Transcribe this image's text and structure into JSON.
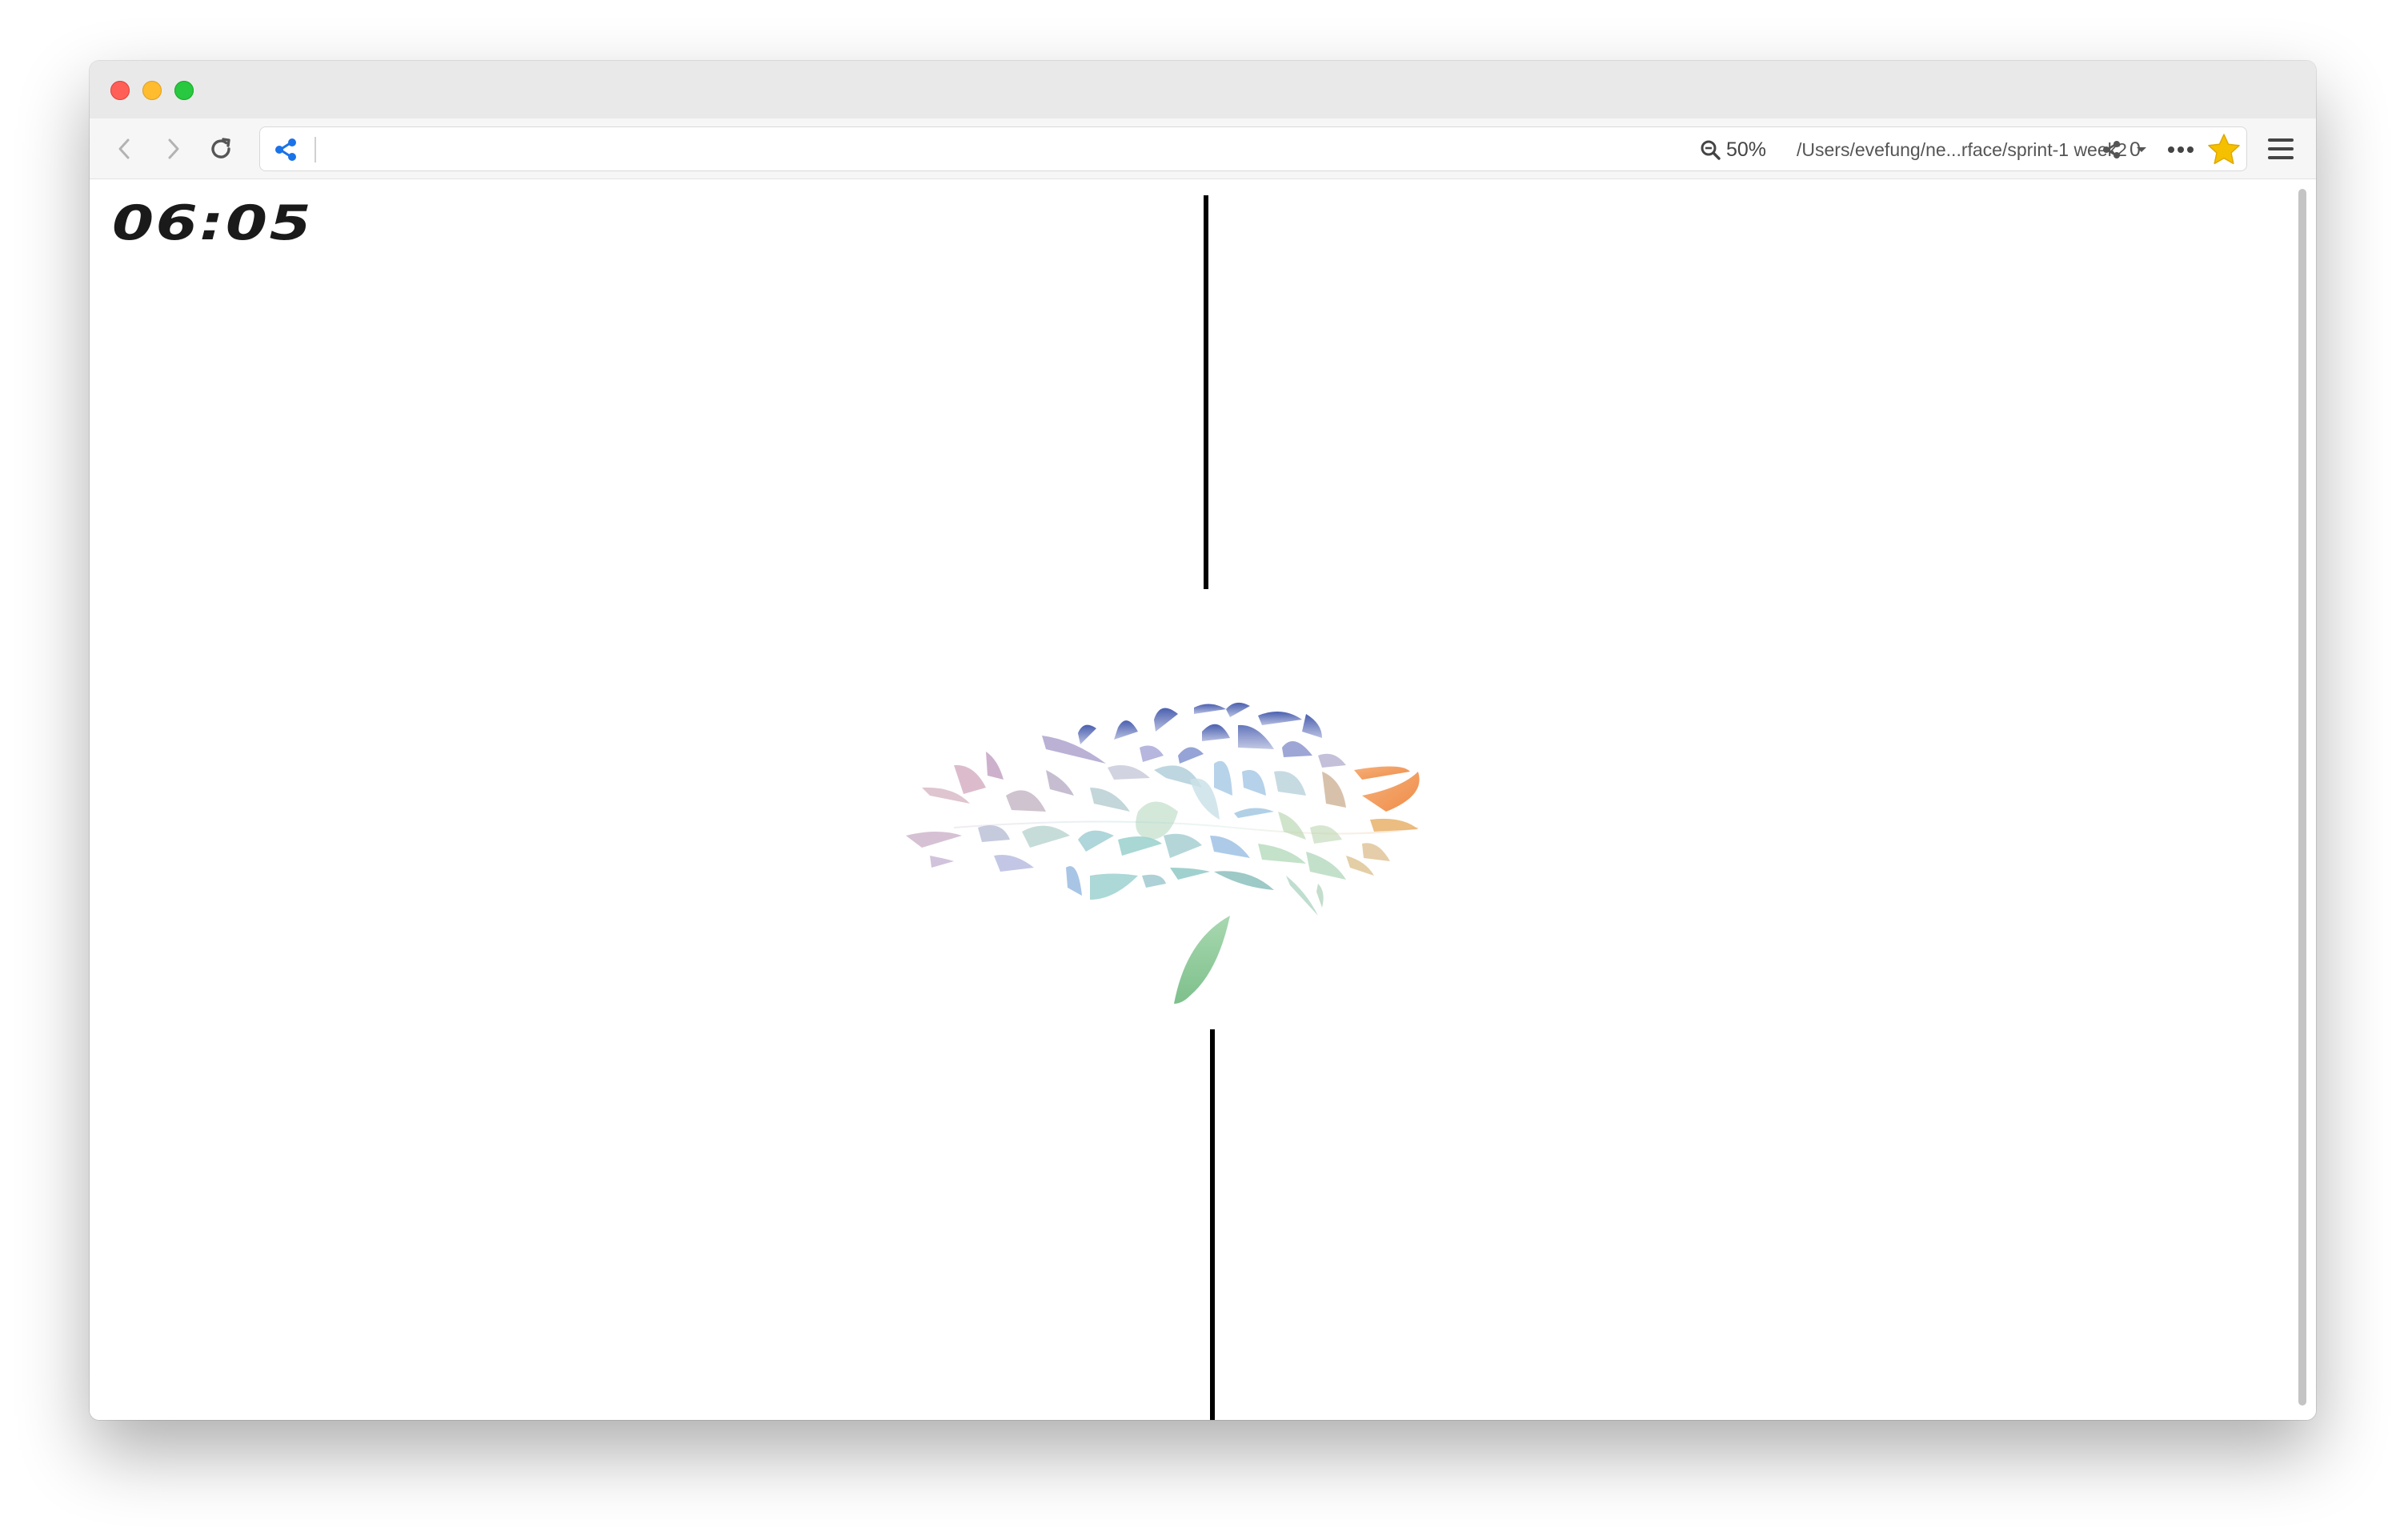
{
  "browser": {
    "zoom": "50%",
    "path": "/Users/evefung/ne...rface/sprint-1 week2",
    "share_count": "0",
    "icons": {
      "back": "chevron-left-icon",
      "forward": "chevron-right-icon",
      "reload": "reload-icon",
      "share": "share-icon",
      "zoom": "magnifier-minus-icon",
      "dropdown": "caret-down-icon",
      "more": "ellipsis-icon",
      "bookmark": "star-icon",
      "menu": "hamburger-icon"
    },
    "colors": {
      "share_accent": "#1a73e8",
      "star": "#f5c000"
    }
  },
  "page": {
    "clock": "06:05",
    "colors": {
      "text": "#1a1a1a",
      "lines": "#000000"
    }
  }
}
